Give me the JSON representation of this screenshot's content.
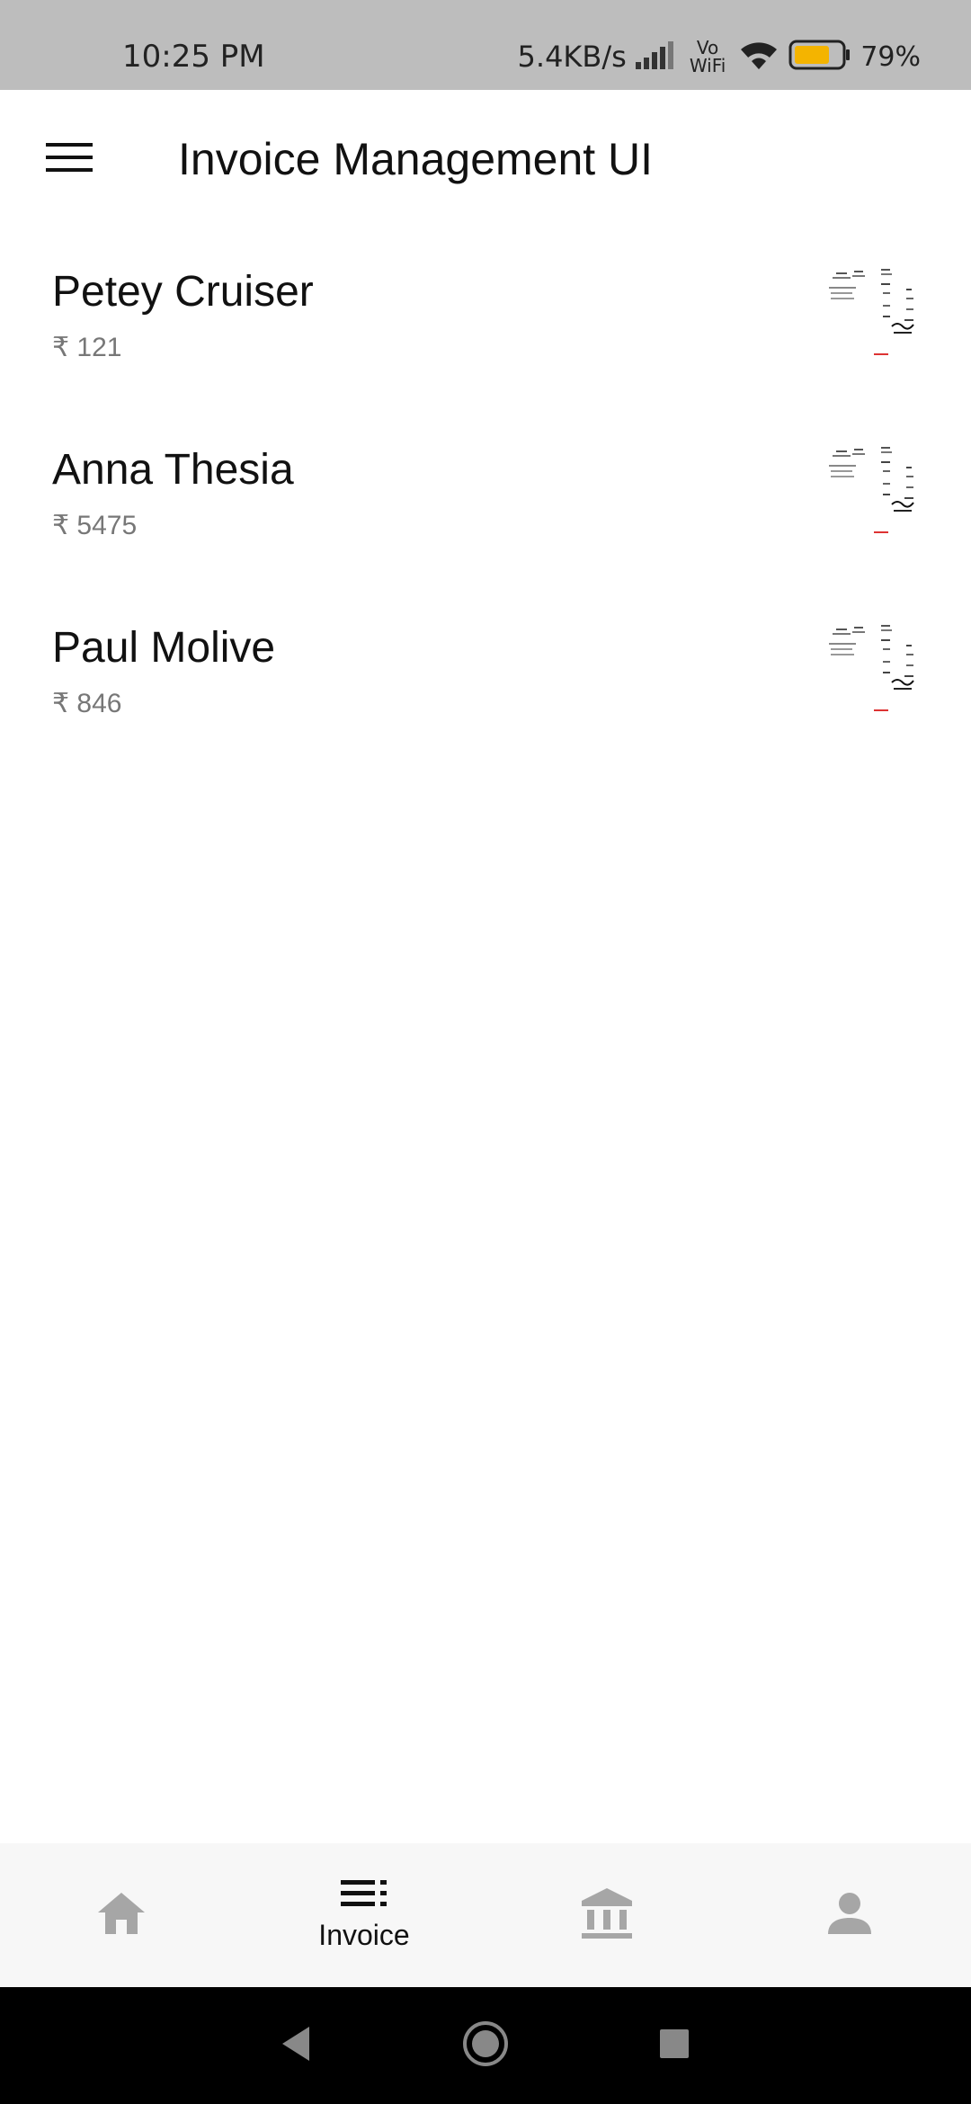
{
  "status_bar": {
    "time": "10:25 PM",
    "network_speed": "5.4KB/s",
    "vowifi_top": "Vo",
    "vowifi_bottom": "WiFi",
    "battery_percent": "79%",
    "battery_color": "#f4b400"
  },
  "app_bar": {
    "title": "Invoice Management UI",
    "menu_icon": "hamburger-menu-icon"
  },
  "invoices": [
    {
      "name": "Petey Cruiser",
      "amount": "₹ 121"
    },
    {
      "name": "Anna Thesia",
      "amount": "₹ 5475"
    },
    {
      "name": "Paul Molive",
      "amount": "₹ 846"
    }
  ],
  "bottom_nav": {
    "items": [
      {
        "icon": "home-icon",
        "label": "",
        "active": false
      },
      {
        "icon": "list-icon",
        "label": "Invoice",
        "active": true
      },
      {
        "icon": "bank-icon",
        "label": "",
        "active": false
      },
      {
        "icon": "person-icon",
        "label": "",
        "active": false
      }
    ],
    "active_color": "#111111",
    "inactive_color": "#a6a6a6"
  },
  "system_nav": {
    "back_icon": "back-triangle-icon",
    "home_icon": "home-circle-icon",
    "recents_icon": "recents-square-icon"
  }
}
